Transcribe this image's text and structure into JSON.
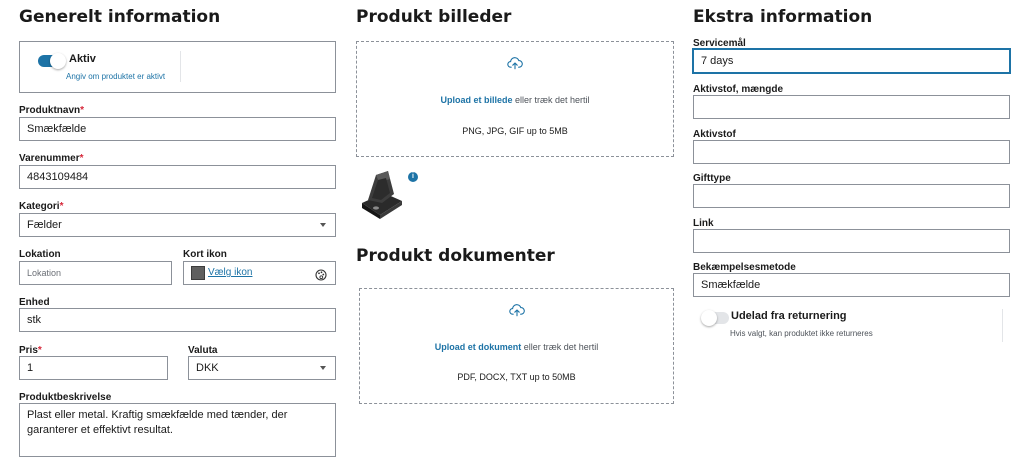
{
  "general": {
    "title": "Generelt information",
    "active_toggle": {
      "label": "Aktiv",
      "hint": "Angiv om produktet er aktivt",
      "on": true
    },
    "product_name": {
      "label": "Produktnavn",
      "required": "*",
      "value": "Smækfælde"
    },
    "item_number": {
      "label": "Varenummer",
      "required": "*",
      "value": "4843109484"
    },
    "category": {
      "label": "Kategori",
      "required": "*",
      "value": "Fælder"
    },
    "location": {
      "label": "Lokation",
      "placeholder": "Lokation"
    },
    "map_icon": {
      "label": "Kort ikon",
      "link": "Vælg ikon",
      "icon": "palette-icon"
    },
    "unit": {
      "label": "Enhed",
      "value": "stk"
    },
    "price": {
      "label": "Pris",
      "required": "*",
      "value": "1"
    },
    "currency": {
      "label": "Valuta",
      "value": "DKK"
    },
    "description": {
      "label": "Produktbeskrivelse",
      "value": "Plast eller metal. Kraftig smækfælde med tænder, der garanterer et effektivt resultat."
    }
  },
  "images": {
    "title": "Produkt billeder",
    "upload_link": "Upload et billede",
    "upload_rest": " eller træk det hertil",
    "hint": "PNG, JPG, GIF up to 5MB",
    "thumb_badge": "i"
  },
  "documents": {
    "title": "Produkt dokumenter",
    "upload_link": "Upload et dokument",
    "upload_rest": " eller træk det hertil",
    "hint": "PDF, DOCX, TXT up to 50MB"
  },
  "extra": {
    "title": "Ekstra information",
    "service_goal": {
      "label": "Servicemål",
      "value": "7 days"
    },
    "active_amount": {
      "label": "Aktivstof, mængde",
      "value": ""
    },
    "active_substance": {
      "label": "Aktivstof",
      "value": ""
    },
    "poison_type": {
      "label": "Gifttype",
      "value": ""
    },
    "link": {
      "label": "Link",
      "value": ""
    },
    "control_method": {
      "label": "Bekæmpelsesmetode",
      "value": "Smækfælde"
    },
    "exclude_returns": {
      "label": "Udelad fra returnering",
      "hint": "Hvis valgt, kan produktet ikke returneres",
      "on": false
    }
  },
  "colors": {
    "accent": "#1d73a6",
    "required": "#d6283a",
    "border": "#8c9199"
  }
}
